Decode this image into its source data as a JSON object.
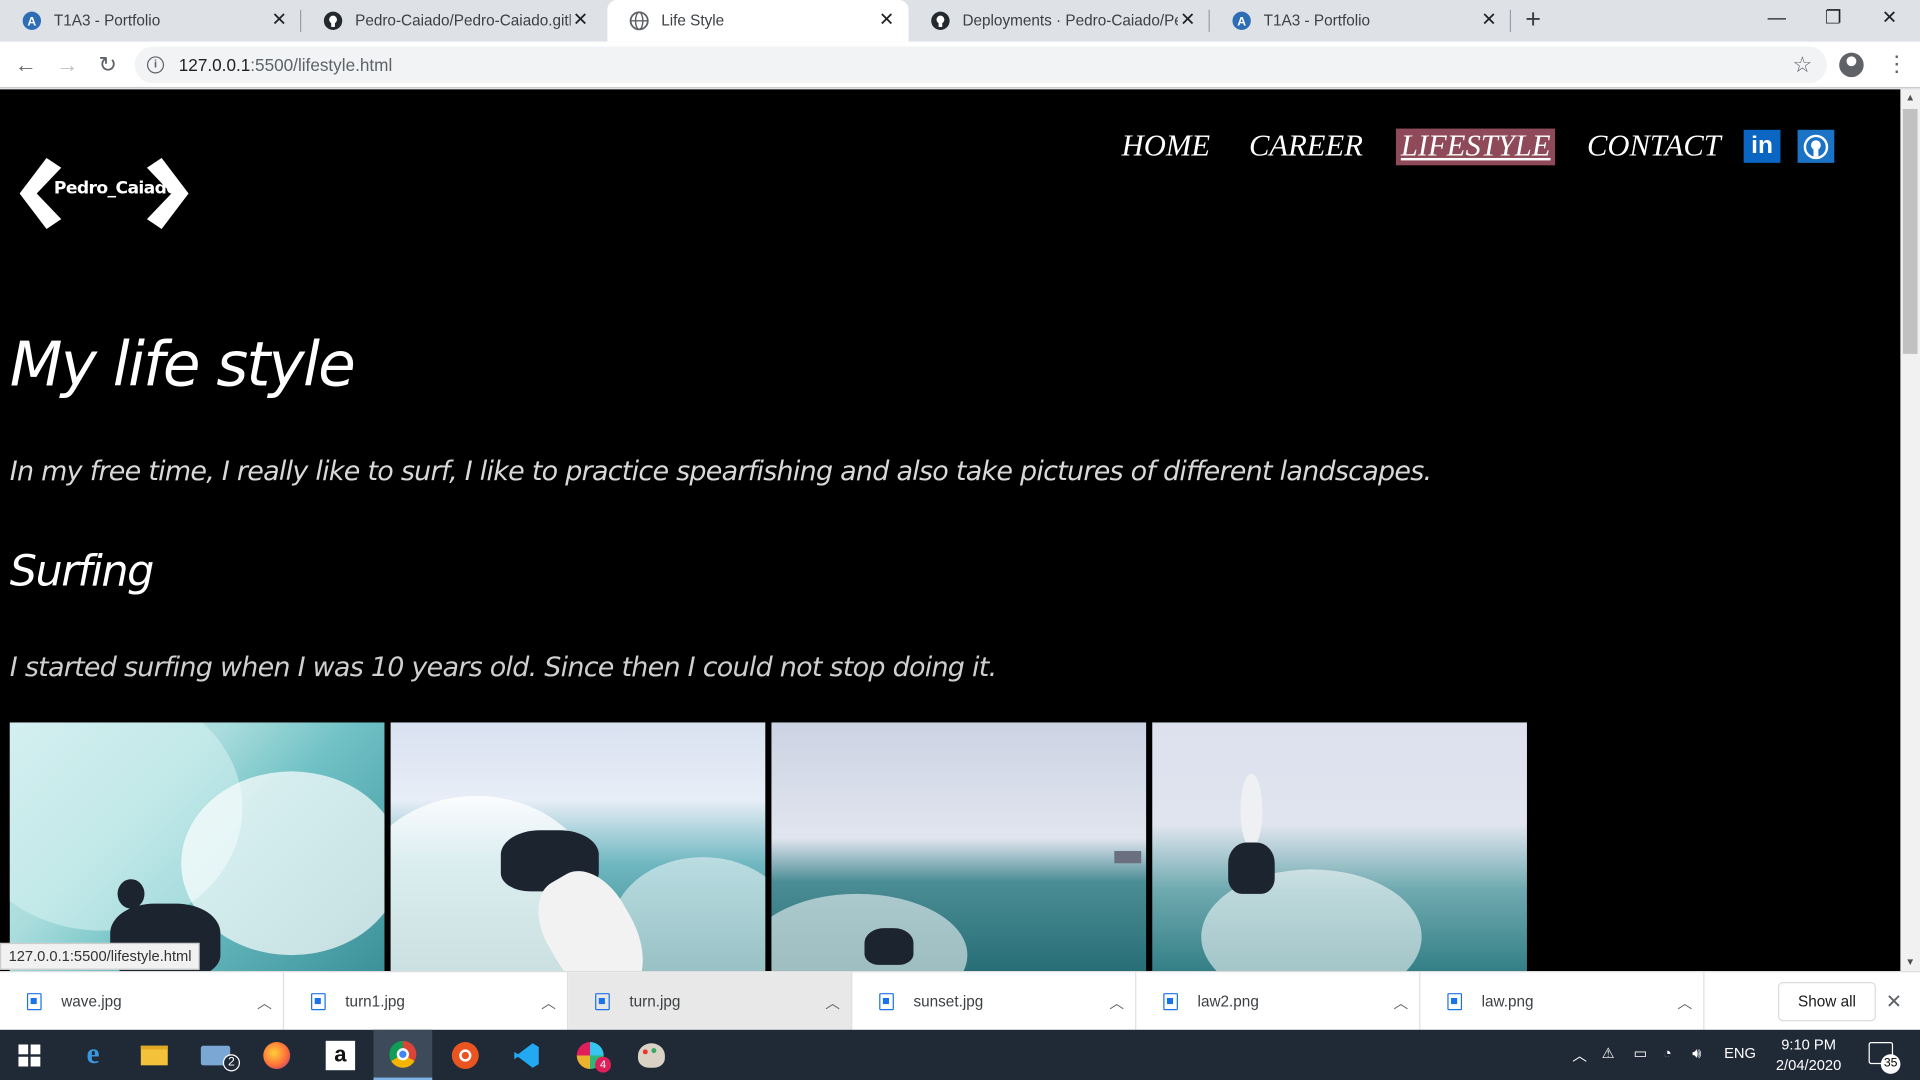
{
  "browser": {
    "tabs": [
      {
        "title": "T1A3 - Portfolio",
        "icon": "portfolio-icon",
        "active": false
      },
      {
        "title": "Pedro-Caiado/Pedro-Caiado.github",
        "icon": "github-icon",
        "active": false
      },
      {
        "title": "Life Style",
        "icon": "globe-icon",
        "active": true
      },
      {
        "title": "Deployments · Pedro-Caiado/Pedro",
        "icon": "github-icon",
        "active": false
      },
      {
        "title": "T1A3 - Portfolio",
        "icon": "portfolio-icon",
        "active": false
      }
    ],
    "new_tab": "+",
    "url_host": "127.0.0.1",
    "url_rest": ":5500/lifestyle.html",
    "status_url": "127.0.0.1:5500/lifestyle.html"
  },
  "page": {
    "logo_text": "Pedro_Caiado",
    "nav": [
      {
        "label": "HOME",
        "active": false
      },
      {
        "label": "CAREER",
        "active": false
      },
      {
        "label": "LIFESTYLE",
        "active": true
      },
      {
        "label": "CONTACT",
        "active": false
      }
    ],
    "social": [
      {
        "name": "linkedin",
        "text": "in"
      },
      {
        "name": "github",
        "text": ""
      }
    ],
    "title": "My life style",
    "intro": "In my free time, I really like to surf, I like to practice spearfishing and also take pictures of different landscapes.",
    "section_title": "Surfing",
    "section_text": "I started surfing when I was 10 years old. Since then I could not stop doing it."
  },
  "downloads": {
    "items": [
      "wave.jpg",
      "turn1.jpg",
      "turn.jpg",
      "sunset.jpg",
      "law2.png",
      "law.png"
    ],
    "show_all": "Show all"
  },
  "taskbar": {
    "mail_badge": "2",
    "slack_badge": "4",
    "lang": "ENG",
    "time": "9:10 PM",
    "date": "2/04/2020",
    "notif_count": "35"
  },
  "colors": {
    "active_nav_bg": "#8e4a58",
    "linkedin": "#0a66c2",
    "taskbar": "#1f2a36"
  }
}
